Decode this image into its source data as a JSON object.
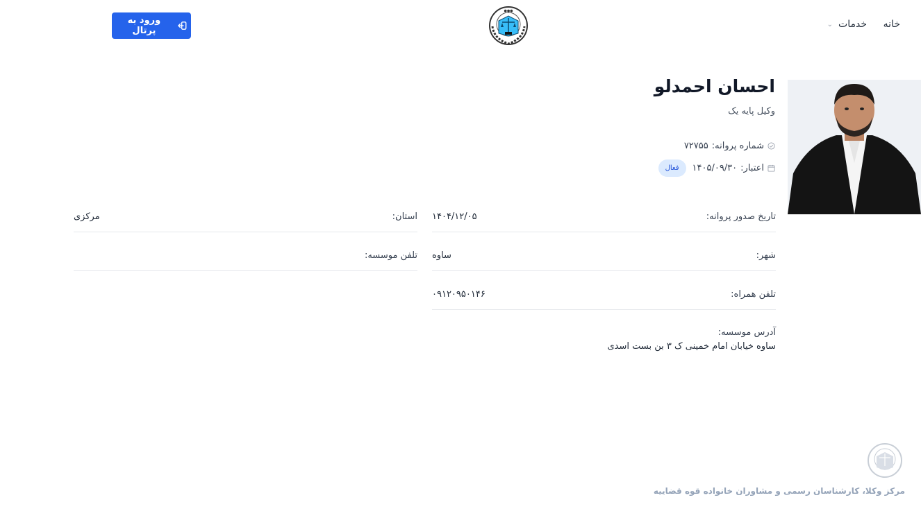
{
  "header": {
    "nav": {
      "home": "خانه",
      "services": "خدمات"
    },
    "login_label": "ورود به پرتال"
  },
  "profile": {
    "name": "احسان احمدلو",
    "rank": "وکیل پایه یک",
    "license_label": "شماره پروانه:",
    "license_number": "۷۲۷۵۵",
    "validity_label": "اعتبار:",
    "validity_date": "۱۴۰۵/۰۹/۳۰",
    "status": "فعال"
  },
  "details": {
    "issue_date_label": "تاریخ صدور پروانه:",
    "issue_date": "۱۴۰۴/۱۲/۰۵",
    "province_label": "استان:",
    "province": "مرکزی",
    "city_label": "شهر:",
    "city": "ساوه",
    "office_phone_label": "تلفن موسسه:",
    "office_phone": "",
    "mobile_label": "تلفن همراه:",
    "mobile": "۰۹۱۲۰۹۵۰۱۴۶",
    "address_label": "آدرس موسسه:",
    "address": "ساوه خیابان امام خمینی ک ۳ بن بست اسدی"
  },
  "footer": {
    "text": "مرکز وکلا، کارشناسان رسمی و مشاوران خانواده قوه قضاییه"
  },
  "colors": {
    "primary": "#2563eb",
    "badge_bg": "#dbeafe",
    "badge_text": "#1d4ed8"
  }
}
